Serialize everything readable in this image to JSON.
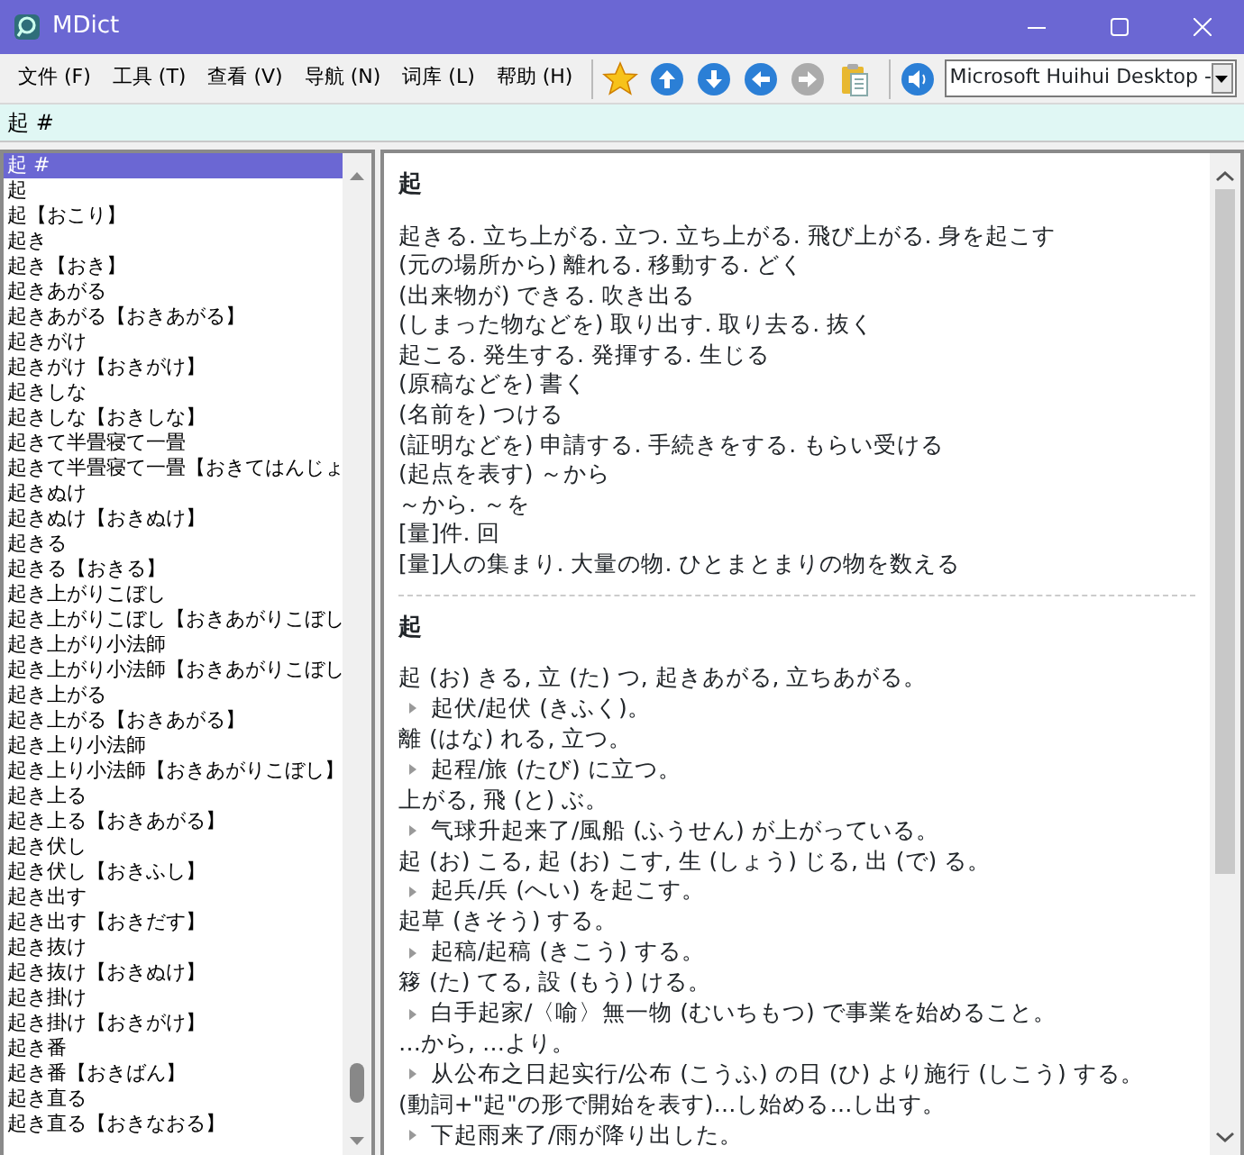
{
  "window": {
    "title": "MDict"
  },
  "menu": [
    "文件 (F)",
    "工具 (T)",
    "查看 (V)",
    "导航 (N)",
    "词库 (L)",
    "帮助 (H)"
  ],
  "toolbar": {
    "buttons": [
      {
        "kind": "star",
        "disabled": false
      },
      {
        "kind": "up",
        "disabled": false
      },
      {
        "kind": "down",
        "disabled": false
      },
      {
        "kind": "back",
        "disabled": false
      },
      {
        "kind": "forward",
        "disabled": true
      },
      {
        "kind": "clipboard",
        "disabled": false
      },
      {
        "kind": "speaker",
        "disabled": false
      }
    ],
    "voice": {
      "value": "Microsoft Huihui Desktop -"
    }
  },
  "search": {
    "value": "起 #"
  },
  "word_list": {
    "items": [
      {
        "text": "起 #",
        "selected": true
      },
      {
        "text": "起",
        "selected": false
      },
      {
        "text": "起【おこり】",
        "selected": false
      },
      {
        "text": "起き",
        "selected": false
      },
      {
        "text": "起き【おき】",
        "selected": false
      },
      {
        "text": "起きあがる",
        "selected": false
      },
      {
        "text": "起きあがる【おきあがる】",
        "selected": false
      },
      {
        "text": "起きがけ",
        "selected": false
      },
      {
        "text": "起きがけ【おきがけ】",
        "selected": false
      },
      {
        "text": "起きしな",
        "selected": false
      },
      {
        "text": "起きしな【おきしな】",
        "selected": false
      },
      {
        "text": "起きて半畳寝て一畳",
        "selected": false
      },
      {
        "text": "起きて半畳寝て一畳【おきてはんじょ",
        "selected": false
      },
      {
        "text": "起きぬけ",
        "selected": false
      },
      {
        "text": "起きぬけ【おきぬけ】",
        "selected": false
      },
      {
        "text": "起きる",
        "selected": false
      },
      {
        "text": "起きる【おきる】",
        "selected": false
      },
      {
        "text": "起き上がりこぼし",
        "selected": false
      },
      {
        "text": "起き上がりこぼし【おきあがりこぼし",
        "selected": false
      },
      {
        "text": "起き上がり小法師",
        "selected": false
      },
      {
        "text": "起き上がり小法師【おきあがりこぼし",
        "selected": false
      },
      {
        "text": "起き上がる",
        "selected": false
      },
      {
        "text": "起き上がる【おきあがる】",
        "selected": false
      },
      {
        "text": "起き上り小法師",
        "selected": false
      },
      {
        "text": "起き上り小法師【おきあがりこぼし】",
        "selected": false
      },
      {
        "text": "起き上る",
        "selected": false
      },
      {
        "text": "起き上る【おきあがる】",
        "selected": false
      },
      {
        "text": "起き伏し",
        "selected": false
      },
      {
        "text": "起き伏し【おきふし】",
        "selected": false
      },
      {
        "text": "起き出す",
        "selected": false
      },
      {
        "text": "起き出す【おきだす】",
        "selected": false
      },
      {
        "text": "起き抜け",
        "selected": false
      },
      {
        "text": "起き抜け【おきぬけ】",
        "selected": false
      },
      {
        "text": "起き掛け",
        "selected": false
      },
      {
        "text": "起き掛け【おきがけ】",
        "selected": false
      },
      {
        "text": "起き番",
        "selected": false
      },
      {
        "text": "起き番【おきばん】",
        "selected": false
      },
      {
        "text": "起き直る",
        "selected": false
      },
      {
        "text": "起き直る【おきなおる】",
        "selected": false
      }
    ]
  },
  "entries": [
    {
      "headword": "起",
      "lines": [
        {
          "kind": "def",
          "text": "起きる. 立ち上がる. 立つ. 立ち上がる. 飛び上がる. 身を起こす"
        },
        {
          "kind": "def",
          "text": "(元の場所から) 離れる. 移動する. どく"
        },
        {
          "kind": "def",
          "text": "(出来物が) できる. 吹き出る"
        },
        {
          "kind": "def",
          "text": "(しまった物などを) 取り出す. 取り去る. 抜く"
        },
        {
          "kind": "def",
          "text": "起こる. 発生する. 発揮する. 生じる"
        },
        {
          "kind": "def",
          "text": "(原稿などを) 書く"
        },
        {
          "kind": "def",
          "text": "(名前を) つける"
        },
        {
          "kind": "def",
          "text": "(証明などを) 申請する. 手続きをする. もらい受ける"
        },
        {
          "kind": "def",
          "text": "(起点を表す) ～から"
        },
        {
          "kind": "def",
          "text": "～から. ～を"
        },
        {
          "kind": "def",
          "text": "[量]件. 回"
        },
        {
          "kind": "def",
          "text": "[量]人の集まり. 大量の物. ひとまとまりの物を数える"
        }
      ]
    },
    {
      "headword": "起",
      "lines": [
        {
          "kind": "def",
          "text": "起 (お) きる, 立 (た) つ, 起きあがる, 立ちあがる。"
        },
        {
          "kind": "ex",
          "text": "起伏/起伏 (きふく)。"
        },
        {
          "kind": "def",
          "text": "離 (はな) れる, 立つ。"
        },
        {
          "kind": "ex",
          "text": "起程/旅 (たび) に立つ。"
        },
        {
          "kind": "def",
          "text": "上がる, 飛 (と) ぶ。"
        },
        {
          "kind": "ex",
          "text": "气球升起来了/風船 (ふうせん) が上がっている。"
        },
        {
          "kind": "def",
          "text": "起 (お) こる, 起 (お) こす, 生 (しょう) じる, 出 (で) る。"
        },
        {
          "kind": "ex",
          "text": "起兵/兵 (へい) を起こす。"
        },
        {
          "kind": "def",
          "text": "起草 (きそう) する。"
        },
        {
          "kind": "ex",
          "text": "起稿/起稿 (きこう) する。"
        },
        {
          "kind": "def",
          "text": "簃 (た) てる, 設 (もう) ける。"
        },
        {
          "kind": "ex",
          "text": "白手起家/〈喻〉無一物 (むいちもつ) で事業を始めること。"
        },
        {
          "kind": "def",
          "text": "…から, …より。"
        },
        {
          "kind": "ex",
          "text": "从公布之日起实行/公布 (こうふ) の日 (ひ) より施行 (しこう) する。"
        },
        {
          "kind": "def",
          "text": "(動詞+\"起\"の形で開始を表す)…し始める…し出す。"
        },
        {
          "kind": "ex",
          "text": "下起雨来了/雨が降り出した。"
        }
      ]
    }
  ]
}
